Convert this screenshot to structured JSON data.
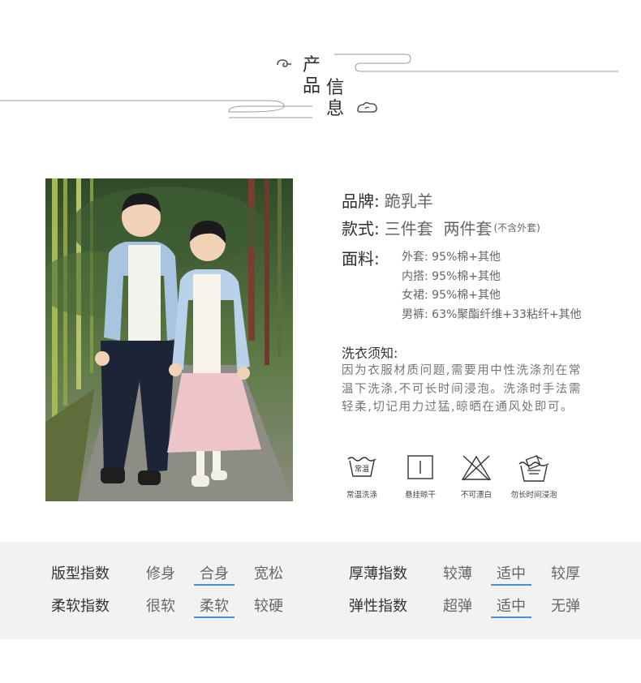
{
  "header": {
    "title_chars": [
      "产",
      "品",
      "信",
      "息"
    ]
  },
  "info": {
    "brand": {
      "label": "品牌:",
      "value": "跪乳羊"
    },
    "style": {
      "label": "款式:",
      "value": "三件套  两件套",
      "note": "(不含外套)"
    },
    "fabric": {
      "label": "面料:",
      "items": [
        "外套: 95%棉+其他",
        "内搭: 95%棉+其他",
        "女裙: 95%棉+其他",
        "男裤: 63%聚酯纤维+33粘纤+其他"
      ]
    },
    "wash": {
      "title": "洗衣须知:",
      "text": "因为衣服材质问题,需要用中性洗涤剂在常温下洗涤,不可长时间浸泡。洗涤时手法需轻柔,切记用力过猛,晾晒在通风处即可。"
    },
    "wash_icons": [
      {
        "icon": "normal-temp-wash-icon",
        "inner": "常温",
        "caption": "常温洗涤"
      },
      {
        "icon": "hang-dry-icon",
        "caption": "悬挂晾干"
      },
      {
        "icon": "no-bleach-icon",
        "caption": "不可漂白"
      },
      {
        "icon": "no-long-soak-icon",
        "caption": "勿长时间浸泡"
      }
    ]
  },
  "indices": [
    {
      "label": "版型指数",
      "options": [
        "修身",
        "合身",
        "宽松"
      ],
      "selected": 1
    },
    {
      "label": "厚薄指数",
      "options": [
        "较薄",
        "适中",
        "较厚"
      ],
      "selected": 1
    },
    {
      "label": "柔软指数",
      "options": [
        "很软",
        "柔软",
        "较硬"
      ],
      "selected": 1
    },
    {
      "label": "弹性指数",
      "options": [
        "超弹",
        "适中",
        "无弹"
      ],
      "selected": 1
    }
  ],
  "colors": {
    "accent": "#4a90d9",
    "band_bg": "#f2f2f2"
  }
}
